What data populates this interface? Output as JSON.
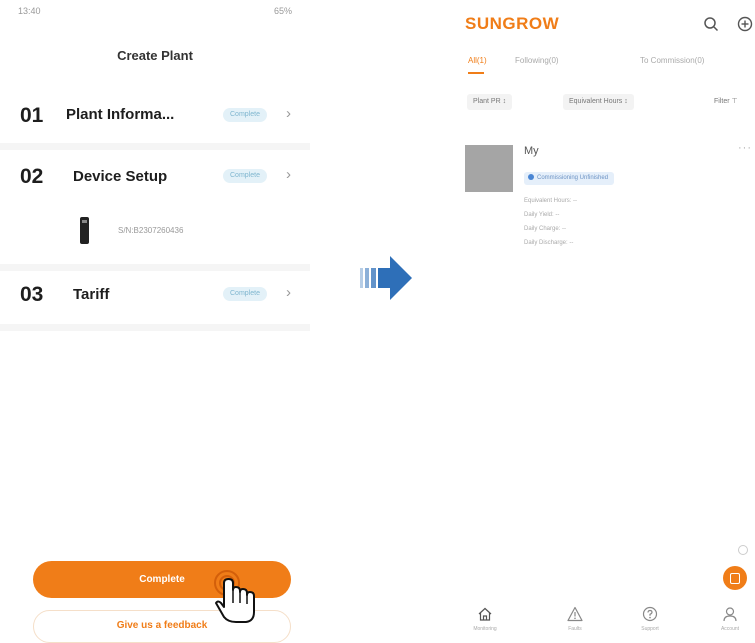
{
  "left_phone": {
    "status_bar": {
      "time": "13:40",
      "system": "65%"
    },
    "header_title": "Create Plant",
    "steps": [
      {
        "num": "01",
        "title": "Plant Informa...",
        "badge": "Complete"
      },
      {
        "num": "02",
        "title": "Device Setup",
        "badge": "Complete"
      },
      {
        "num": "03",
        "title": "Tariff",
        "badge": "Complete"
      }
    ],
    "device": {
      "sn": "S/N:B2307260436"
    },
    "complete_button": "Complete",
    "feedback_button": "Give us a feedback"
  },
  "right_phone": {
    "logo": "SUNGROW",
    "tabs": [
      {
        "label": "All(1)",
        "active": true
      },
      {
        "label": "Following(0)",
        "active": false
      },
      {
        "label": "To Commission(0)",
        "active": false
      }
    ],
    "filters": {
      "chips": [
        "Plant PR ↕",
        "Equivalent Hours ↕"
      ],
      "filter_label": "Filter"
    },
    "plant": {
      "name": "My",
      "status": "Commissioning Unfinished",
      "metrics": [
        "Equivalent Hours: --",
        "Daily Yield: --",
        "Daily Charge: --",
        "Daily Discharge: --"
      ]
    },
    "bottom_nav": [
      {
        "label": "Monitoring",
        "icon": "home-icon"
      },
      {
        "label": "Faults",
        "icon": "warning-icon"
      },
      {
        "label": "Support",
        "icon": "support-icon"
      },
      {
        "label": "Account",
        "icon": "user-icon"
      }
    ]
  },
  "colors": {
    "accent": "#f07d18",
    "arrow": "#2e6fb8",
    "badge_bg": "#e3f1f8",
    "status_blue": "#4a86d4"
  }
}
